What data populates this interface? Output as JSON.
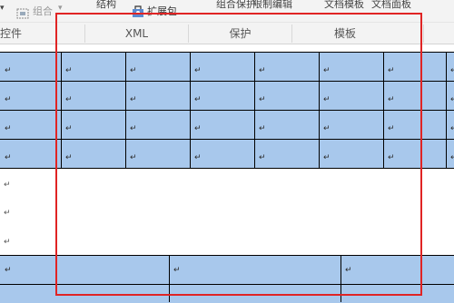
{
  "ribbon": {
    "group_combine_label": "组合",
    "ext_pack_label": "扩展包",
    "partial_labels": [
      "结构",
      "组合保护",
      "限制编辑",
      "文档模板",
      "文档面板"
    ],
    "tabs": [
      {
        "label": "控件"
      },
      {
        "label": "XML"
      },
      {
        "label": "保护"
      },
      {
        "label": "模板"
      }
    ]
  },
  "document": {
    "paragraph_mark": "↵",
    "table_top": {
      "rows": 4,
      "columns": 8
    },
    "table_bottom": {
      "rows": 2,
      "columns": 3
    }
  },
  "colors": {
    "ribbon_bg": "#f3f3f3",
    "cell_fill": "#a8c8ec",
    "highlight_border": "#e02424"
  }
}
